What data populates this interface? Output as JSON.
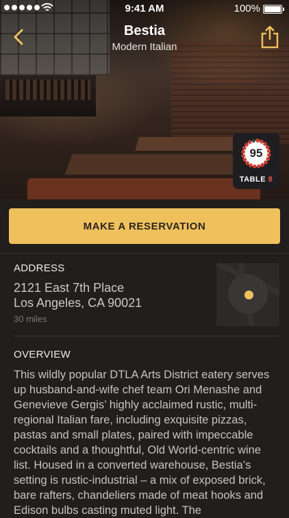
{
  "status_bar": {
    "time": "9:41 AM",
    "battery": "100%"
  },
  "header": {
    "title": "Bestia",
    "subtitle": "Modern Italian"
  },
  "score_badge": {
    "score": "95",
    "label_main": "TABLE",
    "label_num": "8",
    "ring_fraction": 0.95,
    "ring_color": "#d63a2f"
  },
  "actions": {
    "reserve_label": "MAKE A RESERVATION"
  },
  "address": {
    "heading": "ADDRESS",
    "line1": "2121 East 7th Place",
    "line2": "Los Angeles, CA 90021",
    "distance": "30 miles"
  },
  "overview": {
    "heading": "OVERVIEW",
    "text": "This wildly popular DTLA Arts District eatery serves up husband-and-wife chef team Ori Menashe and Genevieve Gergis’ highly acclaimed rustic, multi-regional Italian fare, including exquisite pizzas, pastas and small plates, paired with impeccable cocktails and a thoughtful, Old World-centric wine list. Housed in a converted warehouse, Bestia’s setting is rustic-industrial – a mix of exposed brick, bare rafters, chandeliers made of meat hooks and Edison bulbs casting muted light. The"
  },
  "colors": {
    "accent": "#efc15d",
    "background": "#221e1d"
  },
  "icons": {
    "back": "chevron-left-icon",
    "share": "share-icon",
    "map_pin": "map-pin-icon"
  }
}
